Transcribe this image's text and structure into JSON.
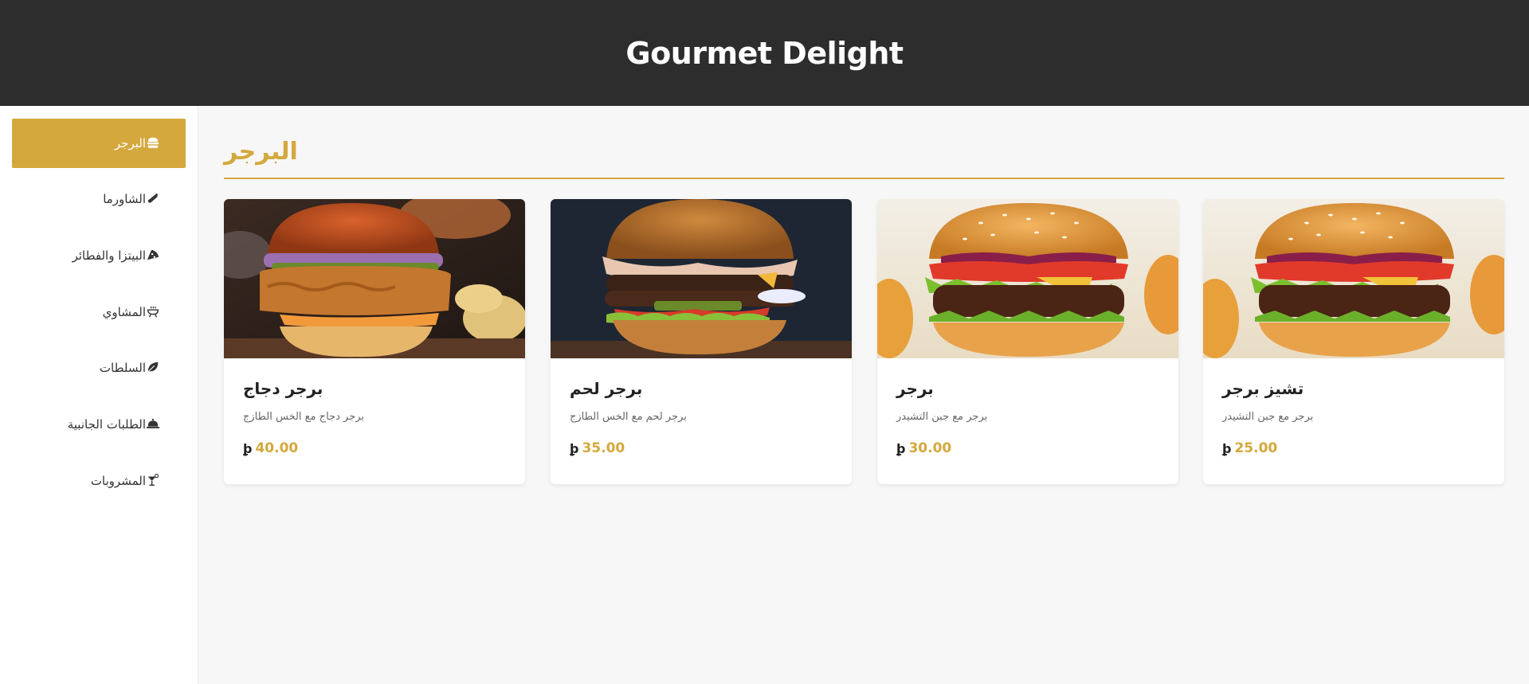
{
  "header": {
    "title": "Gourmet Delight"
  },
  "sidebar": {
    "items": [
      {
        "label": "البرجر",
        "icon": "burger-icon",
        "active": true
      },
      {
        "label": "الشاورما",
        "icon": "shawarma-icon",
        "active": false
      },
      {
        "label": "البيتزا والفطائر",
        "icon": "pizza-icon",
        "active": false
      },
      {
        "label": "المشاوي",
        "icon": "grill-icon",
        "active": false
      },
      {
        "label": "السلطات",
        "icon": "leaf-icon",
        "active": false
      },
      {
        "label": "الطلبات الجانبية",
        "icon": "cloche-icon",
        "active": false
      },
      {
        "label": "المشروبات",
        "icon": "drink-icon",
        "active": false
      }
    ]
  },
  "section": {
    "title": "البرجر"
  },
  "products": [
    {
      "name": "برجر دجاج",
      "description": "برجر دجاج مع الخس الطازج",
      "price": "40.00",
      "currency_symbol": "⃁",
      "image": "chicken-burger-photo"
    },
    {
      "name": "برجر لحم",
      "description": "برجر لحم مع الخس الطازج",
      "price": "35.00",
      "currency_symbol": "⃁",
      "image": "beef-burger-photo"
    },
    {
      "name": "برجر",
      "description": "برجر مع جبن التشيدر",
      "price": "30.00",
      "currency_symbol": "⃁",
      "image": "cheeseburger-photo"
    },
    {
      "name": "تشيز برجر",
      "description": "برجر مع جبن التشيدر",
      "price": "25.00",
      "currency_symbol": "⃁",
      "image": "cheeseburger-photo"
    }
  ],
  "colors": {
    "accent": "#d4a83c",
    "header_bg": "#2d2d2d",
    "page_bg": "#f7f7f7"
  }
}
